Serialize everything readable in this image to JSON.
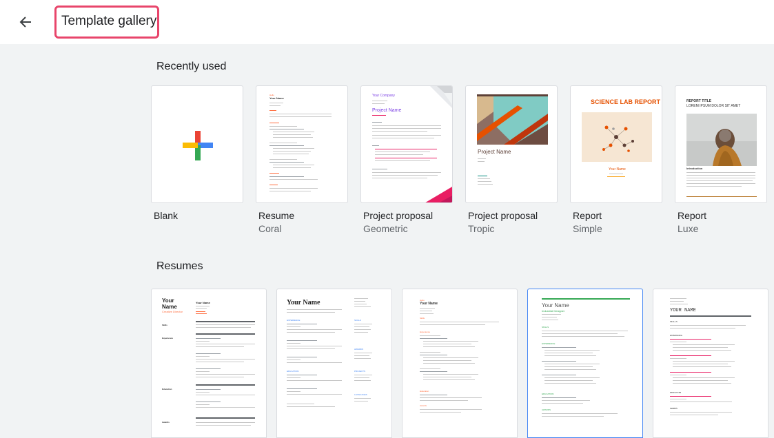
{
  "header": {
    "title": "Template gallery",
    "back_icon": "arrow-left-icon"
  },
  "sections": {
    "recently_used": "Recently used",
    "resumes": "Resumes"
  },
  "recent": [
    {
      "title": "Blank",
      "subtitle": ""
    },
    {
      "title": "Resume",
      "subtitle": "Coral"
    },
    {
      "title": "Project proposal",
      "subtitle": "Geometric"
    },
    {
      "title": "Project proposal",
      "subtitle": "Tropic"
    },
    {
      "title": "Report",
      "subtitle": "Simple"
    },
    {
      "title": "Report",
      "subtitle": "Luxe"
    }
  ],
  "thumbs": {
    "coral_name": "Your Name",
    "geo_company": "Your Company",
    "geo_title": "Project Name",
    "tropic_title": "Project Name",
    "simple_title": "SCIENCE LAB REPORT",
    "simple_name": "Your Name",
    "luxe_title": "REPORT TITLE",
    "luxe_subtitle": "LOREM IPSUM DOLOR SIT AMET",
    "luxe_intro": "Introduction",
    "r1_name_a": "Your",
    "r1_name_b": "Name",
    "r1_role": "Creative Director",
    "r1_label_skills": "Skills",
    "r1_label_exp": "Experience",
    "r1_label_edu": "Education",
    "r1_label_awards": "Awards",
    "r1_right_name": "Your Name",
    "r2_name": "Your Name",
    "r2_exp": "EXPERIENCE",
    "r2_skills": "SKILLS",
    "r2_edu": "EDUCATION",
    "r2_awards": "AWARDS",
    "r2_projects": "PROJECTS",
    "r2_lang": "LANGUAGES",
    "r3_name": "Your Name",
    "r3_skills": "Skills",
    "r3_exp": "Experience",
    "r3_edu": "Education",
    "r3_awards": "Awards",
    "r4_name": "Your Name",
    "r4_role": "Industrial Designer",
    "r4_skills": "SKILLS",
    "r4_exp": "EXPERIENCE",
    "r4_edu": "EDUCATION",
    "r4_awards": "AWARDS",
    "r5_name": "YOUR NAME",
    "r5_skills": "SKILLS",
    "r5_exp": "EXPERIENCE",
    "r5_edu": "EDUCATION",
    "r5_awards": "AWARDS"
  },
  "colors": {
    "highlight": "#e8456b",
    "coral": "#ff6d3f",
    "purple": "#7b3fe4",
    "green": "#34a853",
    "blue": "#4285f4"
  }
}
